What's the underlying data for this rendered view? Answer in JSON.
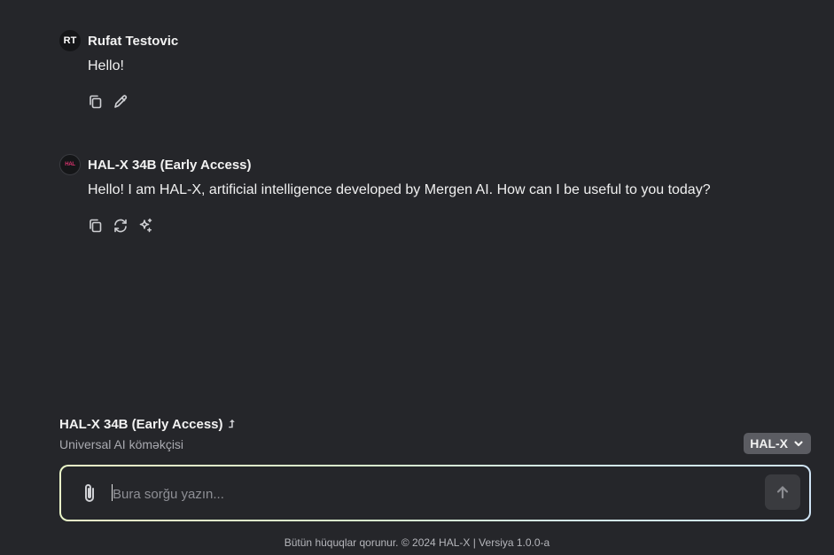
{
  "messages": [
    {
      "avatar": "RT",
      "author": "Rufat Testovic",
      "text": "Hello!",
      "actions": [
        "copy-icon",
        "edit-icon"
      ]
    },
    {
      "avatar": "HAL",
      "author": "HAL-X 34B (Early Access)",
      "text": "Hello! I am HAL-X, artificial intelligence developed by Mergen AI. How can I be useful to you today?",
      "actions": [
        "copy-icon",
        "regenerate-icon",
        "sparkle-icon"
      ]
    }
  ],
  "model_info": {
    "name": "HAL-X 34B (Early Access)",
    "subtitle": "Universal AI köməkçisi"
  },
  "model_select": {
    "value": "HAL-X"
  },
  "composer": {
    "placeholder": "Bura sorğu yazın..."
  },
  "footer": {
    "text": "Bütün hüquqlar qorunur. © 2024 HAL-X | Versiya 1.0.0-a"
  },
  "colors": {
    "background": "#25262a",
    "composer_border_start": "#eaf7c8",
    "composer_border_end": "#cfe4f5",
    "bot_avatar_accent": "#d6336c"
  }
}
